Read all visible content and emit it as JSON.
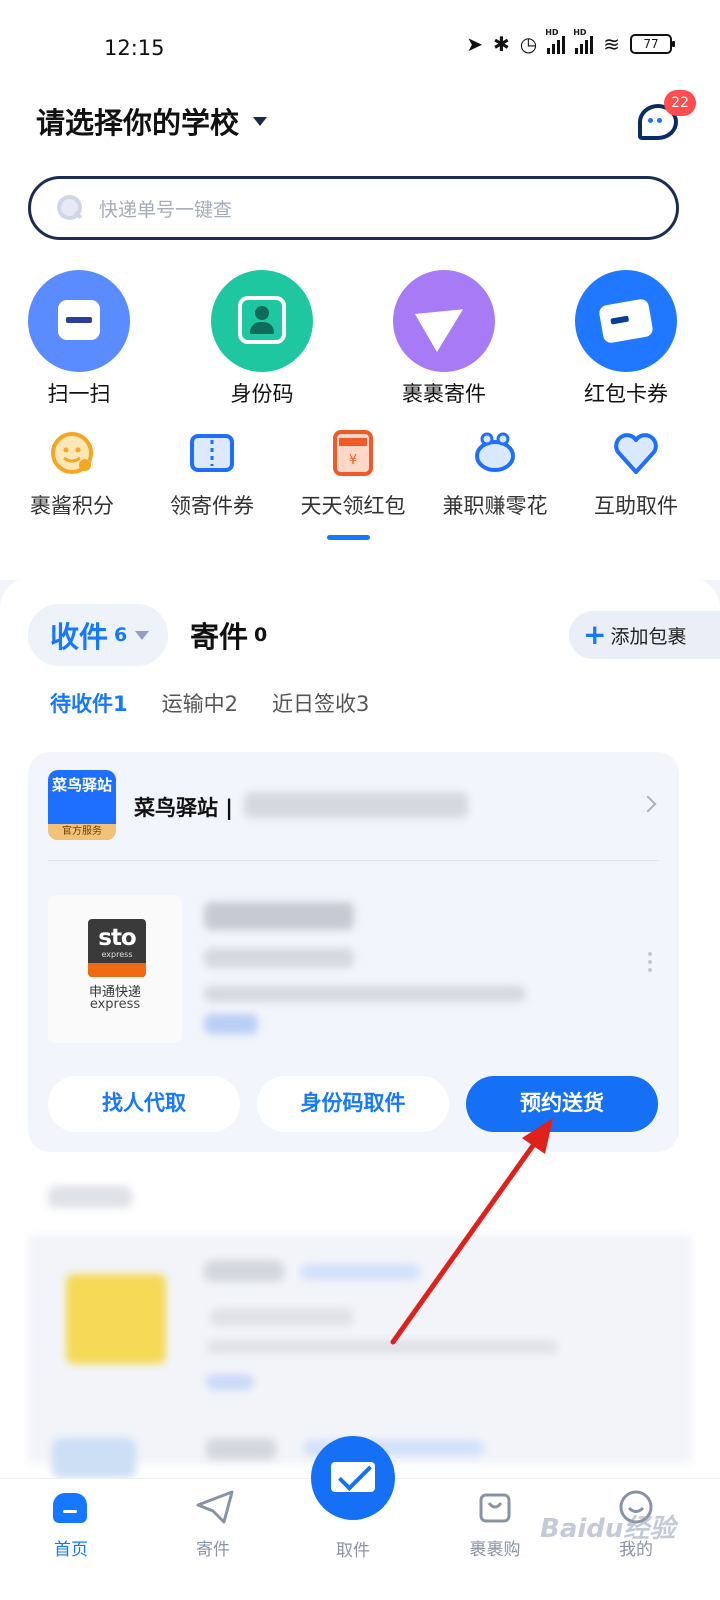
{
  "status_bar": {
    "time": "12:15",
    "battery": "77"
  },
  "header": {
    "school_selector": "请选择你的学校",
    "message_badge": "22"
  },
  "search": {
    "placeholder": "快递单号一键查"
  },
  "quick_actions": [
    {
      "label": "扫一扫",
      "icon": "scan-icon",
      "color": "#5b8cff"
    },
    {
      "label": "身份码",
      "icon": "id-code-icon",
      "color": "#1fc7a0"
    },
    {
      "label": "裹裹寄件",
      "icon": "paper-plane-icon",
      "color": "#a67bf5"
    },
    {
      "label": "红包卡券",
      "icon": "card-icon",
      "color": "#1f78ff"
    }
  ],
  "services": [
    {
      "label": "裹酱积分",
      "icon": "smiley-points-icon"
    },
    {
      "label": "领寄件券",
      "icon": "coupon-icon"
    },
    {
      "label": "天天领红包",
      "icon": "red-envelope-icon"
    },
    {
      "label": "兼职赚零花",
      "icon": "piggy-bank-icon"
    },
    {
      "label": "互助取件",
      "icon": "heart-icon"
    }
  ],
  "packages": {
    "tab_receive": "收件",
    "receive_count": "6",
    "tab_send": "寄件",
    "send_count": "0",
    "add_package": "添加包裹",
    "subtabs": [
      "待收件1",
      "运输中2",
      "近日签收3"
    ]
  },
  "station": {
    "logo_text": "菜鸟驿站",
    "logo_badge": "官方服务",
    "name": "菜鸟驿站 |"
  },
  "courier": {
    "logo_word": "sto",
    "logo_sub": "express",
    "name_cn": "申通快递",
    "name_en": "express"
  },
  "card_actions": {
    "ask_someone": "找人代取",
    "id_pickup": "身份码取件",
    "schedule_delivery": "预约送货"
  },
  "bottom_nav": {
    "home": "首页",
    "send": "寄件",
    "pickup": "取件",
    "shop": "裹裹购",
    "mine": "我的"
  },
  "watermark": "Baidu经验",
  "colors": {
    "accent": "#1677ff",
    "badge": "#ff4d4f",
    "annotation_arrow": "#e0201b"
  }
}
